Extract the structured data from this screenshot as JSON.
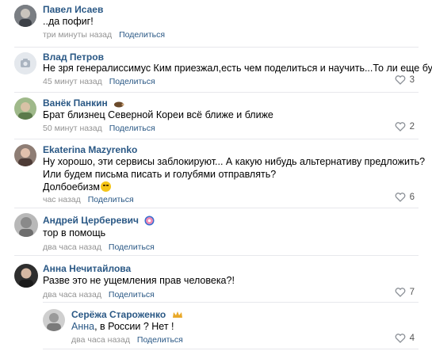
{
  "comments": [
    {
      "author": "Павел Исаев",
      "lines": [
        "..да пофиг!"
      ],
      "time": "три минуты назад",
      "share": "Поделиться",
      "likes": null,
      "avatar": "avatar-photo"
    },
    {
      "author": "Влад Петров",
      "lines": [
        "Не зря генералиссимус Ким приезжал,есть чем поделиться и научить...То ли еще будет."
      ],
      "time": "45 минут назад",
      "share": "Поделиться",
      "likes": "3",
      "avatar": "camera-placeholder-icon"
    },
    {
      "author": "Ванёк Панкин",
      "lines": [
        "Брат близнец Северной Кореи всё ближе и ближе"
      ],
      "time": "50 минут назад",
      "share": "Поделиться",
      "likes": "2",
      "avatar": "avatar-photo",
      "badge": "hedgehog-icon"
    },
    {
      "author": "Ekaterina Mazyrenko",
      "lines": [
        "Ну хорошо, эти сервисы заблокируют... А какую нибудь альтернативу предложить?",
        "Или будем письма писать и голубями отправлять?",
        "Долбоебизм"
      ],
      "time": "час назад",
      "share": "Поделиться",
      "likes": "6",
      "avatar": "avatar-photo"
    },
    {
      "author": "Андрей Церберевич",
      "lines": [
        "тор в помощь"
      ],
      "time": "два часа назад",
      "share": "Поделиться",
      "likes": null,
      "avatar": "avatar-photo",
      "badge": "donut-icon"
    },
    {
      "author": "Анна Нечитайлова",
      "lines": [
        "Разве это не ущемления прав человека?!"
      ],
      "time": "два часа назад",
      "share": "Поделиться",
      "likes": "7",
      "avatar": "avatar-photo"
    }
  ],
  "reply": {
    "author": "Серёжа Староженко",
    "mention": "Анна",
    "text": ", в России ? Нет !",
    "time": "два часа назад",
    "share": "Поделиться",
    "likes": "4",
    "avatar": "avatar-photo",
    "badge": "crown-icon"
  },
  "colors": {
    "link": "#2a5885",
    "meta": "#939393",
    "separator": "#e7e8ec"
  }
}
